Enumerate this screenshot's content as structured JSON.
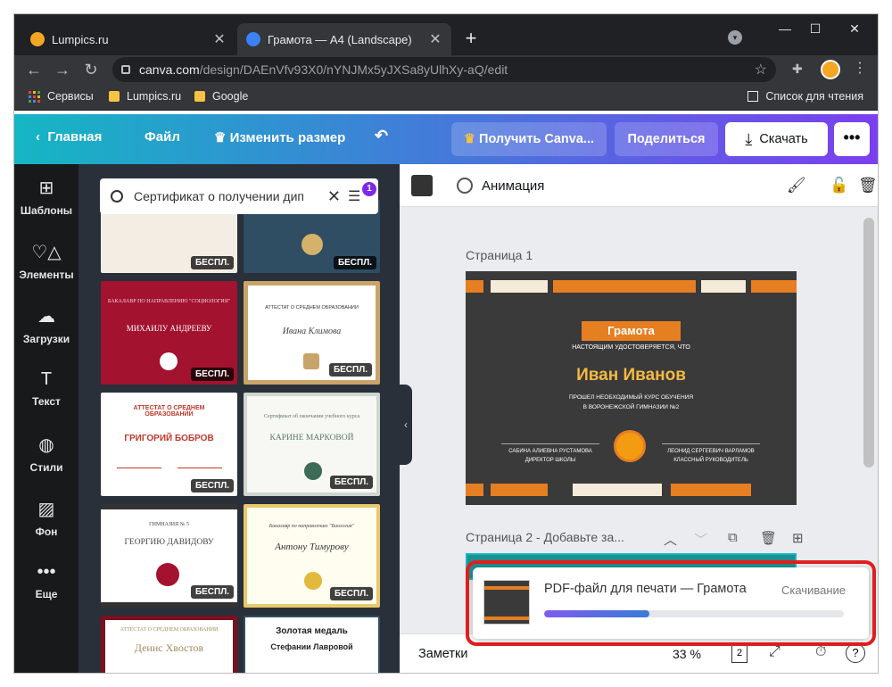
{
  "browser": {
    "tabs": [
      {
        "title": "Lumpics.ru",
        "active": false
      },
      {
        "title": "Грамота — A4 (Landscape)",
        "active": true
      }
    ],
    "url_host": "canva.com",
    "url_path": "/design/DAEnVfv93X0/nYNJMx5yJXSa8yUlhXy-aQ/edit",
    "bookmarks": [
      "Сервисы",
      "Lumpics.ru",
      "Google"
    ],
    "reading_list": "Список для чтения"
  },
  "header": {
    "home": "Главная",
    "file": "Файл",
    "resize": "Изменить размер",
    "get_pro": "Получить Canva...",
    "share": "Поделиться",
    "download": "Скачать"
  },
  "rail": [
    {
      "label": "Шаблоны",
      "icon": "templates-icon"
    },
    {
      "label": "Элементы",
      "icon": "elements-icon"
    },
    {
      "label": "Загрузки",
      "icon": "uploads-icon"
    },
    {
      "label": "Текст",
      "icon": "text-icon"
    },
    {
      "label": "Стили",
      "icon": "styles-icon"
    },
    {
      "label": "Фон",
      "icon": "background-icon"
    },
    {
      "label": "Еще",
      "icon": "more-icon"
    }
  ],
  "search": {
    "query": "Сертификат о получении дип",
    "filter_count": "1"
  },
  "templates": {
    "badge": "БЕСПЛ.",
    "items": [
      {
        "name": "ГРИГОРИЙ БОБРОВ",
        "header": "АТТЕСТАТ О СРЕДНЕМ ОБРАЗОВАНИИ"
      },
      {
        "name": "КАРИНЕ МАРКОВОЙ",
        "header": "Сертификат об окончании учебного курса"
      },
      {
        "name": "ГЕОРГИЮ ДАВИДОВУ",
        "header": "ГИМНАЗИЯ № 5"
      },
      {
        "name": "Антону Тимурову",
        "header": "Бакалавр по направлению \"Биология\""
      },
      {
        "name": "МИХАИЛУ АНДРЕЕВУ",
        "header": "БАКАЛАВР ПО НАПРАВЛЕНИЮ \"СОЦИОЛОГИЯ\""
      },
      {
        "name": "Ивана Климова",
        "header": "АТТЕСТАТ О СРЕДНЕМ ОБРАЗОВАНИИ"
      },
      {
        "name": "Денис Хвостов",
        "header": "АТТЕСТАТ О СРЕДНЕМ ОБРАЗОВАНИИ"
      },
      {
        "name": "Стефании Лавровой",
        "header": "Золотая медаль"
      }
    ]
  },
  "editor": {
    "animation": "Анимация",
    "page1_label": "Страница 1",
    "page2_label": "Страница 2 - Добавьте за...",
    "certificate": {
      "ribbon": "Грамота",
      "line1": "НАСТОЯЩИМ УДОСТОВЕРЯЕТСЯ, ЧТО",
      "name": "Иван Иванов",
      "line2": "ПРОШЕЛ НЕОБХОДИМЫЙ КУРС ОБУЧЕНИЯ",
      "line3": "В ВОРОНЕЖСКОЙ ГИМНАЗИИ №2",
      "sig_left_name": "САБИНА АЛИЕВНА РУСТАМОВА",
      "sig_left_role": "ДИРЕКТОР ШКОЛЫ",
      "sig_right_name": "ЛЕОНИД СЕРГЕЕВИЧ ВАРЛАМОВ",
      "sig_right_role": "КЛАССНЫЙ РУКОВОДИТЕЛЬ"
    },
    "notes": "Заметки",
    "zoom": "33 %",
    "page_count": "2"
  },
  "download_toast": {
    "title": "PDF-файл для печати — Грамота",
    "status": "Скачивание",
    "progress": 0.35
  },
  "colors": {
    "accent_purple": "#7d2ae8",
    "orange": "#e67e22",
    "highlight_red": "#e0201e"
  }
}
